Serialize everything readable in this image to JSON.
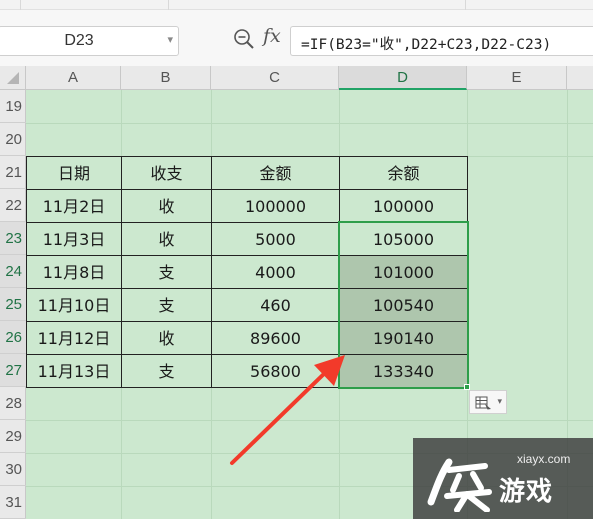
{
  "formula_bar": {
    "name_box": "D23",
    "fx_label": "fx",
    "formula": "=IF(B23=\"收\",D22+C23,D22-C23)"
  },
  "columns": [
    "A",
    "B",
    "C",
    "D",
    "E"
  ],
  "selected_column": "D",
  "rows": [
    "19",
    "20",
    "21",
    "22",
    "23",
    "24",
    "25",
    "26",
    "27",
    "28",
    "29",
    "30",
    "31"
  ],
  "table": {
    "headers": [
      "日期",
      "收支",
      "金额",
      "余额"
    ],
    "rows": [
      [
        "11月2日",
        "收",
        "100000",
        "100000"
      ],
      [
        "11月3日",
        "收",
        "5000",
        "105000"
      ],
      [
        "11月8日",
        "支",
        "4000",
        "101000"
      ],
      [
        "11月10日",
        "支",
        "460",
        "100540"
      ],
      [
        "11月12日",
        "收",
        "89600",
        "190140"
      ],
      [
        "11月13日",
        "支",
        "56800",
        "133340"
      ]
    ]
  },
  "watermark": {
    "url": "xiayx.com",
    "name": "游戏"
  },
  "colors": {
    "sheet_bg": "#cce8cf",
    "selection_border": "#2e9e4a",
    "selection_fill": "#aec6ad",
    "arrow": "#f23a2a"
  }
}
